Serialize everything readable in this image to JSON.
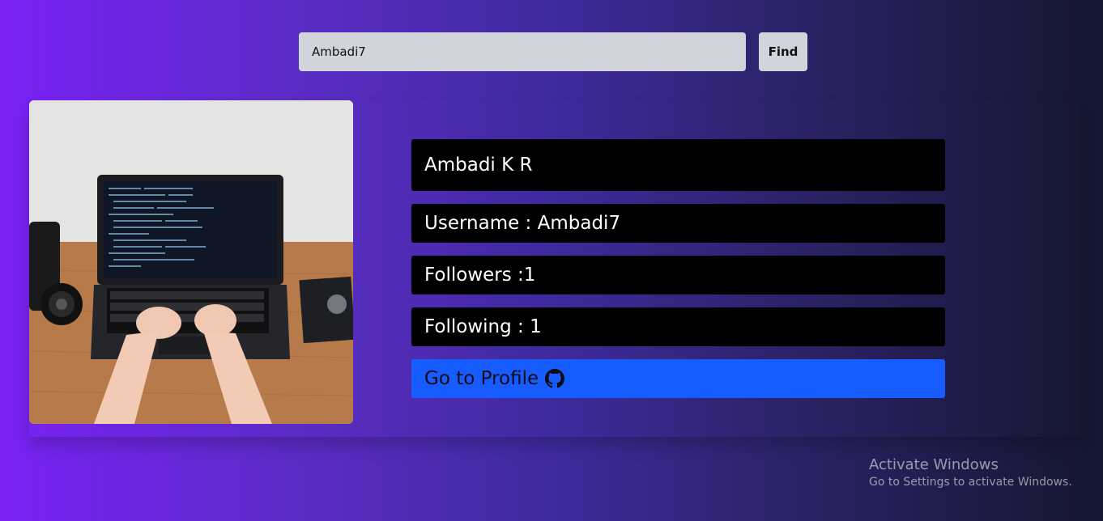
{
  "search": {
    "value": "Ambadi7",
    "button_label": "Find"
  },
  "profile": {
    "name": "Ambadi K R",
    "username_text": "Username : Ambadi7",
    "followers_text": "Followers :1",
    "following_text": "Following : 1",
    "link_label": "Go to Profile",
    "link_icon": "github-icon",
    "photo_icon": "laptop-photo"
  },
  "watermark": {
    "title": "Activate Windows",
    "subtitle": "Go to Settings to activate Windows."
  },
  "colors": {
    "background_start": "#7a22f5",
    "background_end": "#141730",
    "info_box": "#000000",
    "profile_button": "#175cff",
    "input_bg": "#d1d5db"
  }
}
